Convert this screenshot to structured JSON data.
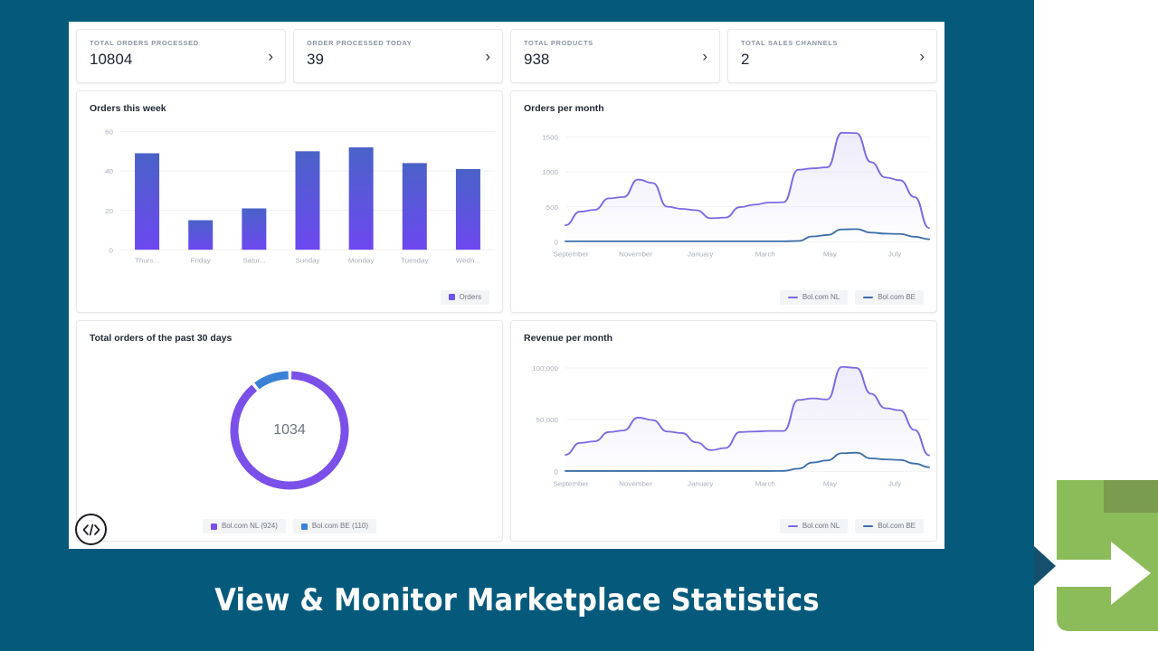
{
  "theme": {
    "backdrop": "#055a7c",
    "chevron": "#14506e",
    "purple": "#7a5af0",
    "purple_dark": "#4a62c8",
    "blue": "#3b82d6",
    "line_purple": "#7b6ae0",
    "line_blue": "#3c6fa8",
    "green_light": "#8cbc5a",
    "green_dark": "#7a9c4e"
  },
  "banner": {
    "title": "View & Monitor Marketplace Statistics"
  },
  "stats": [
    {
      "label": "TOTAL ORDERS PROCESSED",
      "value": "10804",
      "chevron": "chevron-right-icon"
    },
    {
      "label": "ORDER PROCESSED TODAY",
      "value": "39",
      "chevron": "chevron-right-icon"
    },
    {
      "label": "TOTAL PRODUCTS",
      "value": "938",
      "chevron": "chevron-right-icon"
    },
    {
      "label": "TOTAL SALES CHANNELS",
      "value": "2",
      "chevron": "chevron-right-icon"
    }
  ],
  "panels": {
    "orders_week": {
      "title": "Orders this week"
    },
    "orders_month": {
      "title": "Orders per month"
    },
    "orders_30days": {
      "title": "Total orders of the past 30 days"
    },
    "revenue_month": {
      "title": "Revenue per month"
    }
  },
  "code_badge": {
    "icon": "code-icon"
  },
  "chart_data": [
    {
      "id": "orders_week",
      "type": "bar",
      "title": "Orders this week",
      "categories": [
        "Thurs...",
        "Friday",
        "Satur...",
        "Sunday",
        "Monday",
        "Tuesday",
        "Wedn..."
      ],
      "values": [
        49,
        15,
        21,
        50,
        52,
        44,
        41
      ],
      "yticks": [
        0,
        20,
        40,
        60
      ],
      "ylim": [
        0,
        60
      ],
      "xlabel": "",
      "ylabel": "",
      "grid": true,
      "legend": [
        {
          "name": "Orders",
          "color": "#6d54ee",
          "marker": "square"
        }
      ],
      "legend_position": "bottom-right"
    },
    {
      "id": "orders_month",
      "type": "area",
      "title": "Orders per month",
      "xticks": [
        "September",
        "November",
        "January",
        "March",
        "May",
        "July"
      ],
      "yticks": [
        0,
        500,
        1000,
        1500
      ],
      "ylim": [
        0,
        1600
      ],
      "series": [
        {
          "name": "Bol.com NL",
          "color": "#7b6ae0",
          "values": [
            235,
            430,
            455,
            620,
            640,
            890,
            840,
            500,
            470,
            450,
            335,
            345,
            495,
            530,
            560,
            565,
            1030,
            1050,
            1065,
            1560,
            1555,
            1140,
            920,
            880,
            640,
            195
          ]
        },
        {
          "name": "Bol.com BE",
          "color": "#3c6fa8",
          "values": [
            5,
            5,
            5,
            5,
            5,
            5,
            5,
            5,
            5,
            5,
            5,
            5,
            5,
            5,
            5,
            5,
            10,
            75,
            95,
            175,
            180,
            130,
            115,
            110,
            70,
            35
          ]
        }
      ],
      "legend_position": "bottom-right"
    },
    {
      "id": "orders_30days",
      "type": "pie",
      "title": "Total orders of the past 30 days",
      "center_value": "1034",
      "labels": [
        "Bol.com NL (924)",
        "Bol.com BE (110)"
      ],
      "values": [
        924,
        110
      ],
      "colors": [
        "#7a50e8",
        "#3b82d6"
      ],
      "legend_position": "bottom-center"
    },
    {
      "id": "revenue_month",
      "type": "area",
      "title": "Revenue per month",
      "xticks": [
        "September",
        "November",
        "January",
        "March",
        "May",
        "July"
      ],
      "yticks": [
        0,
        50000,
        100000
      ],
      "ytick_labels": [
        "0",
        "50,000",
        "100,000"
      ],
      "ylim": [
        0,
        108000
      ],
      "series": [
        {
          "name": "Bol.com NL",
          "color": "#7b6ae0",
          "values": [
            16000,
            27500,
            29000,
            38000,
            39500,
            52000,
            49500,
            38500,
            37000,
            28000,
            20500,
            22500,
            38000,
            38500,
            39000,
            39000,
            69000,
            70500,
            69500,
            101000,
            100000,
            75000,
            61000,
            59000,
            40000,
            15500
          ]
        },
        {
          "name": "Bol.com BE",
          "color": "#3c6fa8",
          "values": [
            300,
            300,
            300,
            300,
            300,
            300,
            300,
            300,
            300,
            300,
            300,
            300,
            300,
            300,
            300,
            400,
            2500,
            8500,
            10500,
            17500,
            18000,
            12500,
            11500,
            11000,
            7500,
            4000
          ]
        }
      ],
      "legend_position": "bottom-right"
    }
  ]
}
